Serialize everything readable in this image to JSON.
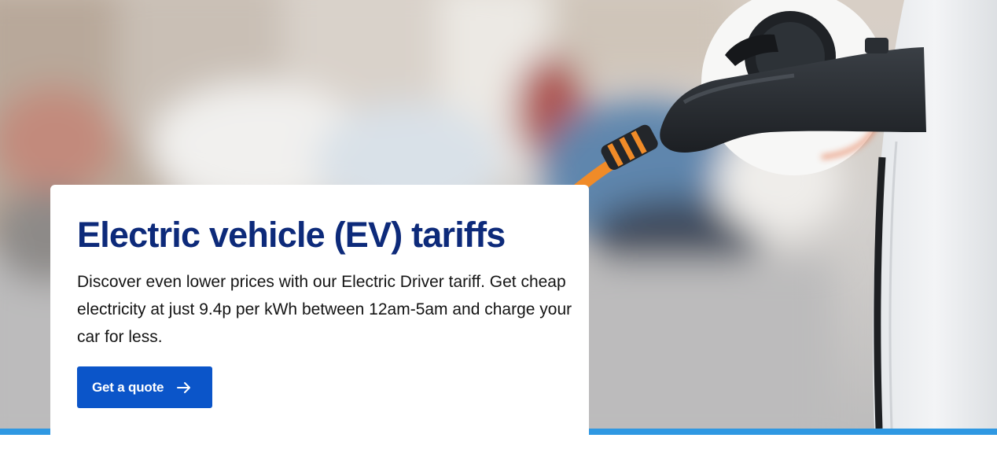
{
  "hero": {
    "image": "blurred-street-ev-charging-photo",
    "colors": {
      "plug": "#2b2f34",
      "cable": "#f08b28",
      "car_body": "#eef0f2"
    }
  },
  "card": {
    "title": "Electric vehicle (EV) tariffs",
    "body": "Discover even lower prices with our Electric Driver tariff. Get cheap electricity at just 9.4p per kWh between 12am-5am and charge your car for less.",
    "cta": {
      "label": "Get a quote",
      "icon": "arrow-right-icon"
    }
  },
  "colors": {
    "title": "#0d2a7a",
    "button": "#0b55c9",
    "accent_strip": "#2f98e2"
  }
}
